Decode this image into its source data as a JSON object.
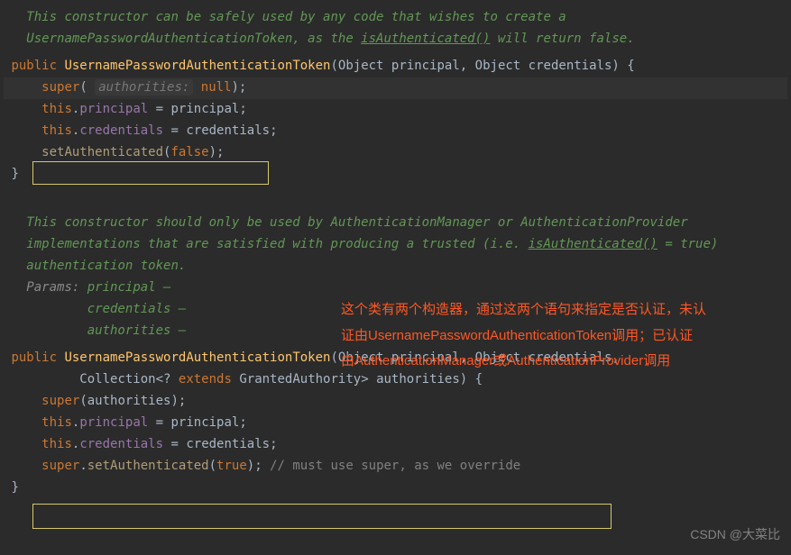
{
  "doc1": {
    "line1_a": "This constructor can be safely used by any code that wishes to create a",
    "line2_a": "UsernamePasswordAuthenticationToken",
    "line2_b": ", as the ",
    "line2_c": "isAuthenticated()",
    "line2_d": " will return ",
    "line2_e": "false",
    "line2_f": "."
  },
  "code1": {
    "public": "public",
    "class_name": "UsernamePasswordAuthenticationToken",
    "obj_type": "Object",
    "principal_param": "principal",
    "credentials_param": "credentials",
    "super_kw": "super",
    "hint_auth": "authorities:",
    "null_kw": "null",
    "this_kw": "this",
    "principal_field": "principal",
    "credentials_field": "credentials",
    "set_auth": "setAuthenticated",
    "false_kw": "false"
  },
  "doc2": {
    "line1_a": "This constructor should only be used by ",
    "line1_b": "AuthenticationManager",
    "line1_c": " or ",
    "line1_d": "AuthenticationProvider",
    "line2_a": "implementations that are satisfied with producing a trusted (i.e. ",
    "line2_b": "isAuthenticated()",
    "line2_c": " = ",
    "line2_d": "true",
    "line2_e": ")",
    "line3_a": "authentication token.",
    "params_label": "Params:",
    "p_principal": "principal –",
    "p_credentials": "credentials –",
    "p_authorities": "authorities –"
  },
  "code2": {
    "public": "public",
    "class_name": "UsernamePasswordAuthenticationToken",
    "obj_type": "Object",
    "principal_param": "principal",
    "credentials_param": "credentials",
    "collection": "Collection",
    "wildcard": "<? ",
    "extends": "extends",
    "granted": " GrantedAuthority> ",
    "authorities_param": "authorities",
    "super_kw": "super",
    "this_kw": "this",
    "principal_field": "principal",
    "credentials_field": "credentials",
    "set_auth": "setAuthenticated",
    "true_kw": "true",
    "comment": "// must use super, as we override"
  },
  "annotation": {
    "line1": "这个类有两个构造器，通过这两个语句来指定是否认证，未认",
    "line2": "证由UsernamePasswordAuthenticationToken调用；已认证",
    "line3": "由AuthenticationManager或AuthenticationProvider调用"
  },
  "watermark": "CSDN @大菜比"
}
